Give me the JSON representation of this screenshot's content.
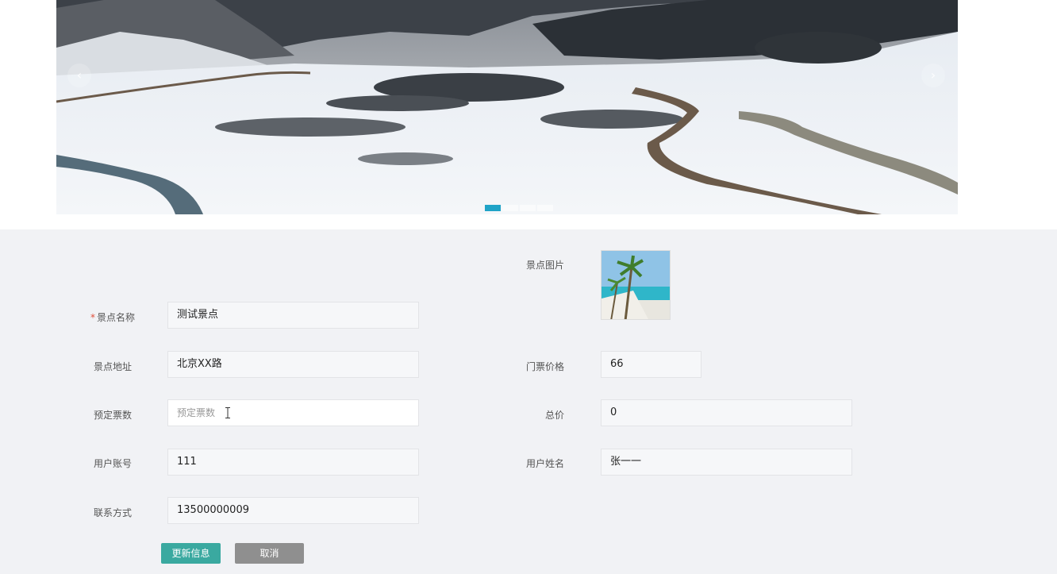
{
  "banner": {
    "prev_label": "‹",
    "next_label": "›",
    "slides": [
      {
        "active": true
      },
      {
        "active": false
      },
      {
        "active": false
      },
      {
        "active": false
      }
    ]
  },
  "form": {
    "image_label": "景点图片",
    "required_mark": "*",
    "name_label": "景点名称",
    "name_value": "测试景点",
    "address_label": "景点地址",
    "address_value": "北京XX路",
    "price_label": "门票价格",
    "price_value": "66",
    "tickets_label": "预定票数",
    "tickets_placeholder": "预定票数",
    "total_label": "总价",
    "total_value": "0",
    "account_label": "用户账号",
    "account_value": "111",
    "username_label": "用户姓名",
    "username_value": "张一一",
    "contact_label": "联系方式",
    "contact_value": "13500000009"
  },
  "buttons": {
    "update_label": "更新信息",
    "cancel_label": "取消"
  }
}
